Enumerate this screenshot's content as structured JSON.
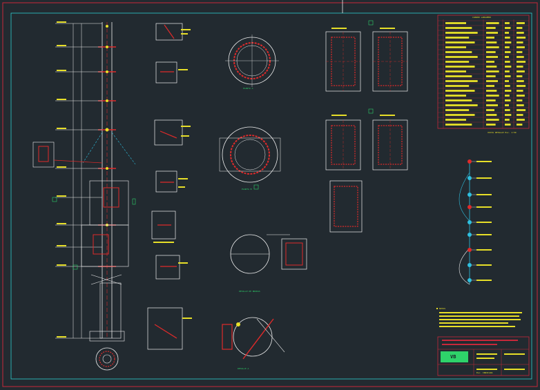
{
  "palette": {
    "background": "#222a30",
    "sheet_border": "#c8283a",
    "drawing_frame": "#2fd0d0",
    "steel_line": "#f0f0f0",
    "weld_red": "#e02a2a",
    "dimension_yellow": "#e8e028",
    "label_green": "#2ed36a",
    "leader_cyan": "#2fc0e0"
  },
  "bom_table": {
    "title": "CUADRO LARGUERO",
    "caption": "VISTA DETALLE Esc. 1:50",
    "row_count": 22
  },
  "notes": {
    "heading": "NOTAS",
    "line_count": 5
  },
  "title_block": {
    "company_logo_text": "VB",
    "scale_label": "Esc. INDICADA"
  },
  "section_labels": {
    "section_a": "PLANTA A",
    "section_b": "PLANTA B",
    "section_c": "DETALLE DE BRIDAS",
    "section_d": "DETALLE A"
  },
  "icons": {
    "north_marker": "north-arrow-icon"
  }
}
